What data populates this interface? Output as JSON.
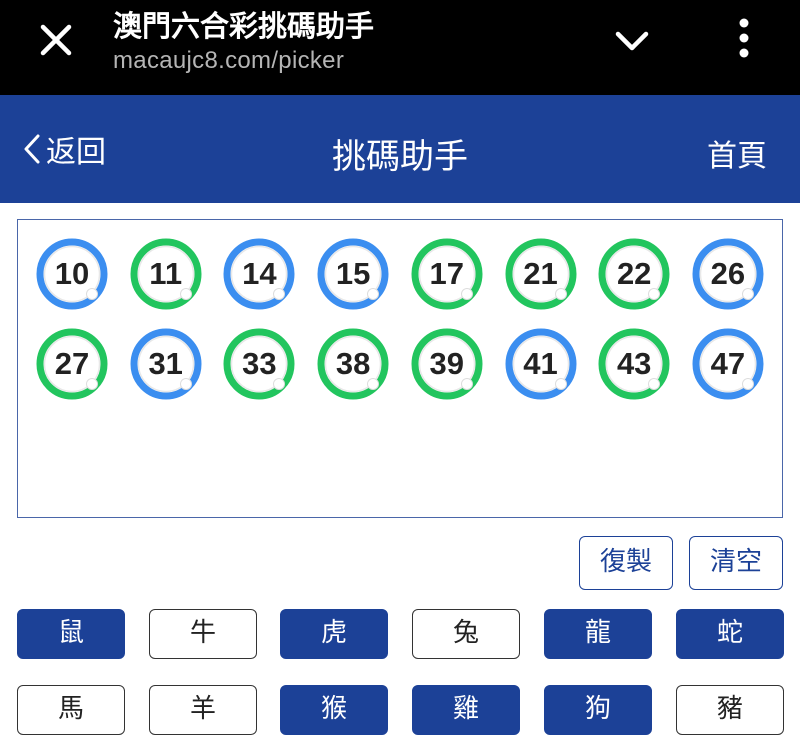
{
  "browser": {
    "title": "澳門六合彩挑碼助手",
    "url": "macaujc8.com/picker",
    "close_icon": "close-icon",
    "chevron_icon": "chevron-down-icon",
    "menu_icon": "more-vertical-icon"
  },
  "nav": {
    "back_label": "返回",
    "title": "挑碼助手",
    "home_label": "首頁"
  },
  "colors": {
    "brand": "#1c4197",
    "ball_green": "#22c55e",
    "ball_blue": "#3b8ef0"
  },
  "balls": [
    {
      "number": "10",
      "color": "blue"
    },
    {
      "number": "11",
      "color": "green"
    },
    {
      "number": "14",
      "color": "blue"
    },
    {
      "number": "15",
      "color": "blue"
    },
    {
      "number": "17",
      "color": "green"
    },
    {
      "number": "21",
      "color": "green"
    },
    {
      "number": "22",
      "color": "green"
    },
    {
      "number": "26",
      "color": "blue"
    },
    {
      "number": "27",
      "color": "green"
    },
    {
      "number": "31",
      "color": "blue"
    },
    {
      "number": "33",
      "color": "green"
    },
    {
      "number": "38",
      "color": "green"
    },
    {
      "number": "39",
      "color": "green"
    },
    {
      "number": "41",
      "color": "blue"
    },
    {
      "number": "43",
      "color": "green"
    },
    {
      "number": "47",
      "color": "blue"
    }
  ],
  "actions": {
    "copy_label": "復製",
    "clear_label": "清空"
  },
  "zodiacs": [
    {
      "label": "鼠",
      "selected": true
    },
    {
      "label": "牛",
      "selected": false
    },
    {
      "label": "虎",
      "selected": true
    },
    {
      "label": "兔",
      "selected": false
    },
    {
      "label": "龍",
      "selected": true
    },
    {
      "label": "蛇",
      "selected": true
    },
    {
      "label": "馬",
      "selected": false
    },
    {
      "label": "羊",
      "selected": false
    },
    {
      "label": "猴",
      "selected": true
    },
    {
      "label": "雞",
      "selected": true
    },
    {
      "label": "狗",
      "selected": true
    },
    {
      "label": "豬",
      "selected": false
    }
  ]
}
